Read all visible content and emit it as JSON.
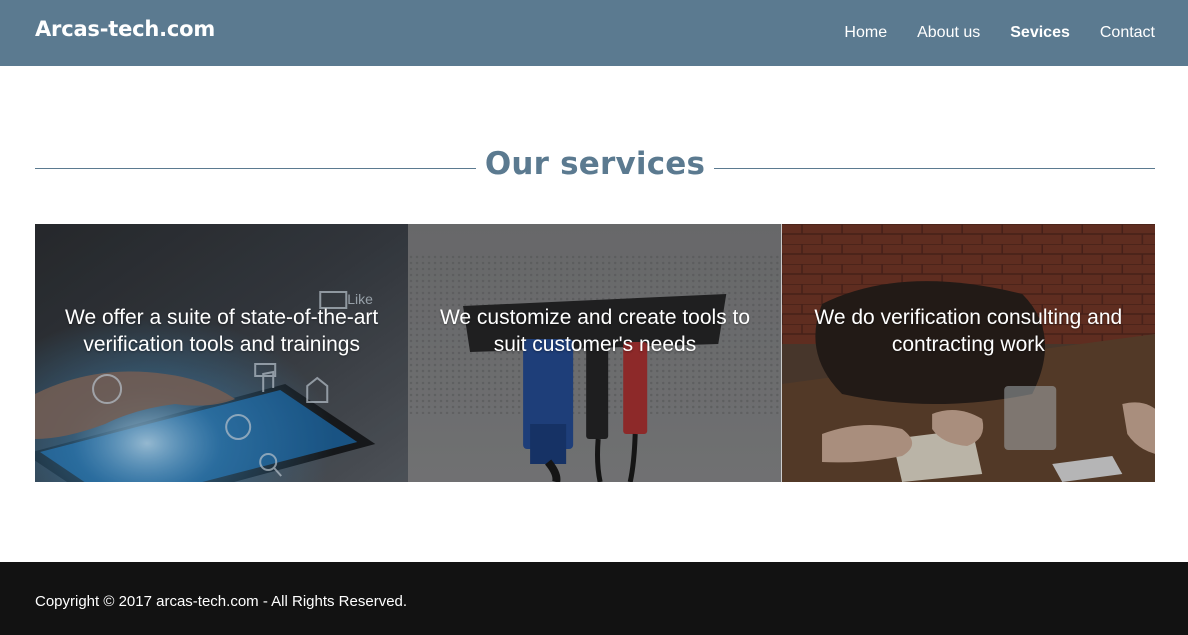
{
  "header": {
    "brand": "Arcas-tech.com",
    "nav": [
      {
        "label": "Home",
        "active": false
      },
      {
        "label": "About us",
        "active": false
      },
      {
        "label": "Sevices",
        "active": true
      },
      {
        "label": "Contact",
        "active": false
      }
    ],
    "color": "#5b7a90"
  },
  "services": {
    "title": "Our services",
    "cards": [
      {
        "caption": "We offer a suite of state-of-the-art verification tools and trainings",
        "image": "tablet-touch-photo",
        "overlay_text": "Like"
      },
      {
        "caption": "We customize and create tools to suit customer's needs",
        "image": "cable-connectors-photo"
      },
      {
        "caption": "We do verification consulting and contracting work",
        "image": "meeting-desk-photo"
      }
    ]
  },
  "footer": {
    "copyright": "Copyright © 2017 arcas-tech.com - All Rights Reserved.",
    "color": "#121212"
  }
}
